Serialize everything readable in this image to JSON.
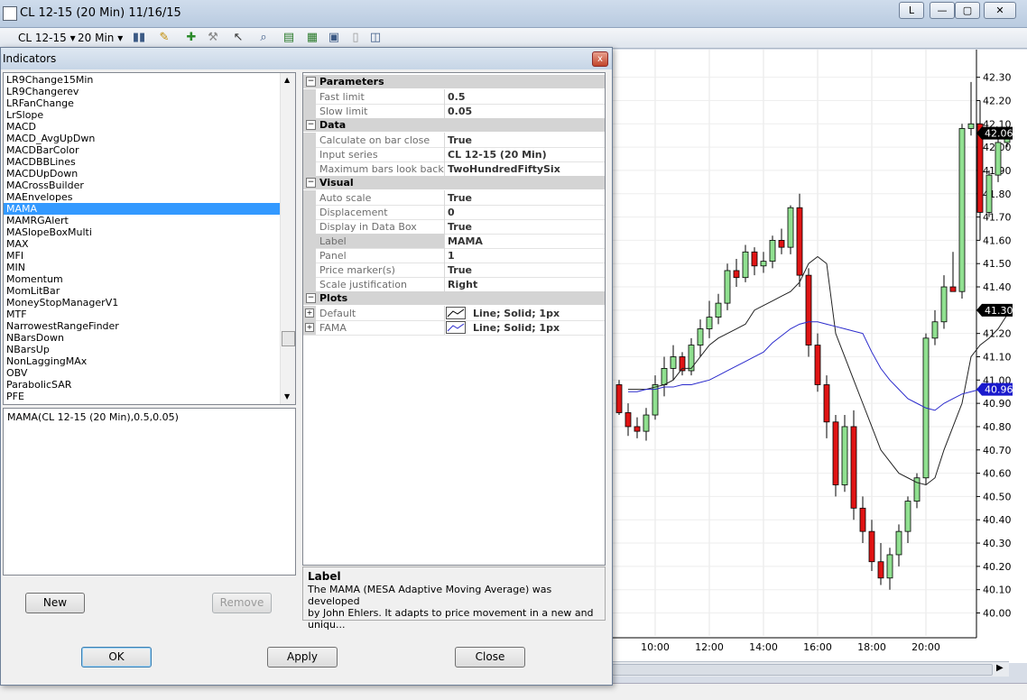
{
  "window": {
    "title": "CL 12-15 (20 Min)  11/16/15",
    "buttons": {
      "l_label": "L",
      "minimize_label": "—",
      "maximize_label": "▢",
      "close_label": "✕"
    }
  },
  "toolbar": {
    "instrument": "CL 12-15",
    "interval": "20 Min"
  },
  "dialog": {
    "title": "Indicators",
    "close_label": "x",
    "indicators": [
      "LR9Change15Min",
      "LR9Changerev",
      "LRFanChange",
      "LrSlope",
      "MACD",
      "MACD_AvgUpDwn",
      "MACDBarColor",
      "MACDBBLines",
      "MACDUpDown",
      "MACrossBuilder",
      "MAEnvelopes",
      "MAMA",
      "MAMRGAlert",
      "MASlopeBoxMulti",
      "MAX",
      "MFI",
      "MIN",
      "Momentum",
      "MomLitBar",
      "MoneyStopManagerV1",
      "MTF",
      "NarrowestRangeFinder",
      "NBarsDown",
      "NBarsUp",
      "NonLaggingMAx",
      "OBV",
      "ParabolicSAR",
      "PFE"
    ],
    "selected_index": 11,
    "expression": "MAMA(CL 12-15 (20 Min),0.5,0.05)",
    "new_label": "New",
    "remove_label": "Remove",
    "ok_label": "OK",
    "apply_label": "Apply",
    "close_button_label": "Close",
    "properties": {
      "parameters": {
        "title": "Parameters",
        "rows": [
          [
            "Fast limit",
            "0.5"
          ],
          [
            "Slow limit",
            "0.05"
          ]
        ]
      },
      "data": {
        "title": "Data",
        "rows": [
          [
            "Calculate on bar close",
            "True"
          ],
          [
            "Input series",
            "CL 12-15 (20 Min)"
          ],
          [
            "Maximum bars look back",
            "TwoHundredFiftySix"
          ]
        ]
      },
      "visual": {
        "title": "Visual",
        "rows": [
          [
            "Auto scale",
            "True"
          ],
          [
            "Displacement",
            "0"
          ],
          [
            "Display in Data Box",
            "True"
          ],
          [
            "Label",
            "MAMA"
          ],
          [
            "Panel",
            "1"
          ],
          [
            "Price marker(s)",
            "True"
          ],
          [
            "Scale justification",
            "Right"
          ]
        ]
      },
      "plots": {
        "title": "Plots",
        "rows": [
          [
            "Default",
            "Line; Solid; 1px"
          ],
          [
            "FAMA",
            "Line; Solid; 1px"
          ]
        ]
      }
    },
    "help_title": "Label",
    "help_text_1": "The MAMA (MESA Adaptive Moving Average) was developed",
    "help_text_2": "by John Ehlers. It adapts to price movement in a new and uniqu..."
  },
  "chart_data": {
    "type": "candlestick",
    "y_ticks": [
      "42.30",
      "42.20",
      "42.10",
      "42.00",
      "41.90",
      "41.80",
      "41.70",
      "41.60",
      "41.50",
      "41.40",
      "41.30",
      "41.20",
      "41.10",
      "41.00",
      "40.90",
      "40.80",
      "40.70",
      "40.60",
      "40.50",
      "40.40",
      "40.30",
      "40.20",
      "40.10",
      "40.00"
    ],
    "x_ticks": [
      "10:00",
      "12:00",
      "14:00",
      "16:00",
      "18:00",
      "20:00"
    ],
    "ylim": [
      39.94,
      42.38
    ],
    "price_markers": [
      "42.06",
      "41.30",
      "40.96"
    ],
    "marker_colors": [
      "#000000",
      "#000000",
      "#1a1acc"
    ],
    "colors": {
      "up": "#90e090",
      "down": "#e01414",
      "mama": "#222222",
      "fama": "#2b2bcc"
    },
    "candles": [
      [
        40.98,
        41.0,
        40.85,
        40.86
      ],
      [
        40.86,
        40.9,
        40.76,
        40.8
      ],
      [
        40.8,
        40.84,
        40.75,
        40.78
      ],
      [
        40.78,
        40.88,
        40.74,
        40.85
      ],
      [
        40.85,
        41.02,
        40.83,
        40.98
      ],
      [
        40.98,
        41.1,
        40.93,
        41.05
      ],
      [
        41.05,
        41.15,
        41.0,
        41.1
      ],
      [
        41.1,
        41.12,
        41.02,
        41.04
      ],
      [
        41.04,
        41.18,
        41.02,
        41.15
      ],
      [
        41.15,
        41.26,
        41.1,
        41.22
      ],
      [
        41.22,
        41.34,
        41.18,
        41.27
      ],
      [
        41.27,
        41.37,
        41.24,
        41.33
      ],
      [
        41.33,
        41.5,
        41.3,
        41.47
      ],
      [
        41.47,
        41.52,
        41.4,
        41.44
      ],
      [
        41.44,
        41.58,
        41.42,
        41.55
      ],
      [
        41.55,
        41.57,
        41.45,
        41.49
      ],
      [
        41.49,
        41.55,
        41.46,
        41.51
      ],
      [
        41.51,
        41.62,
        41.48,
        41.6
      ],
      [
        41.6,
        41.65,
        41.54,
        41.57
      ],
      [
        41.57,
        41.75,
        41.54,
        41.74
      ],
      [
        41.74,
        41.8,
        41.4,
        41.45
      ],
      [
        41.45,
        41.48,
        41.1,
        41.15
      ],
      [
        41.15,
        41.2,
        40.95,
        40.98
      ],
      [
        40.98,
        41.02,
        40.75,
        40.82
      ],
      [
        40.82,
        40.85,
        40.5,
        40.55
      ],
      [
        40.55,
        40.85,
        40.52,
        40.8
      ],
      [
        40.8,
        40.87,
        40.4,
        40.45
      ],
      [
        40.45,
        40.5,
        40.3,
        40.35
      ],
      [
        40.35,
        40.4,
        40.18,
        40.22
      ],
      [
        40.22,
        40.3,
        40.12,
        40.15
      ],
      [
        40.15,
        40.28,
        40.1,
        40.25
      ],
      [
        40.25,
        40.38,
        40.2,
        40.35
      ],
      [
        40.35,
        40.5,
        40.3,
        40.48
      ],
      [
        40.48,
        40.6,
        40.45,
        40.58
      ],
      [
        40.58,
        41.2,
        40.55,
        41.18
      ],
      [
        41.18,
        41.3,
        41.15,
        41.25
      ],
      [
        41.25,
        41.45,
        41.22,
        41.4
      ],
      [
        41.4,
        41.55,
        41.38,
        41.38
      ],
      [
        41.38,
        42.1,
        41.35,
        42.08
      ],
      [
        42.08,
        42.28,
        42.05,
        42.1
      ],
      [
        42.1,
        42.2,
        41.6,
        41.72
      ],
      [
        41.72,
        41.9,
        41.7,
        41.88
      ],
      [
        41.88,
        42.05,
        41.85,
        42.02
      ],
      [
        42.02,
        42.06,
        42.0,
        42.06
      ]
    ],
    "mama": [
      40.96,
      40.96,
      40.96,
      40.97,
      40.98,
      41.0,
      41.05,
      41.05,
      41.1,
      41.15,
      41.18,
      41.2,
      41.22,
      41.24,
      41.3,
      41.32,
      41.34,
      41.36,
      41.38,
      41.42,
      41.5,
      41.53,
      41.5,
      41.2,
      41.1,
      41.0,
      40.9,
      40.8,
      40.7,
      40.65,
      40.6,
      40.58,
      40.56,
      40.55,
      40.58,
      40.7,
      40.8,
      40.9,
      41.1,
      41.15,
      41.18,
      41.22,
      41.28
    ],
    "fama": [
      40.95,
      40.95,
      40.96,
      40.96,
      40.97,
      40.97,
      40.98,
      40.98,
      40.99,
      41.0,
      41.02,
      41.04,
      41.06,
      41.08,
      41.1,
      41.12,
      41.16,
      41.19,
      41.22,
      41.24,
      41.25,
      41.25,
      41.24,
      41.23,
      41.22,
      41.21,
      41.2,
      41.12,
      41.05,
      41.0,
      40.96,
      40.92,
      40.9,
      40.88,
      40.87,
      40.9,
      40.92,
      40.94,
      40.95,
      40.96,
      40.97,
      40.96,
      40.96
    ]
  }
}
